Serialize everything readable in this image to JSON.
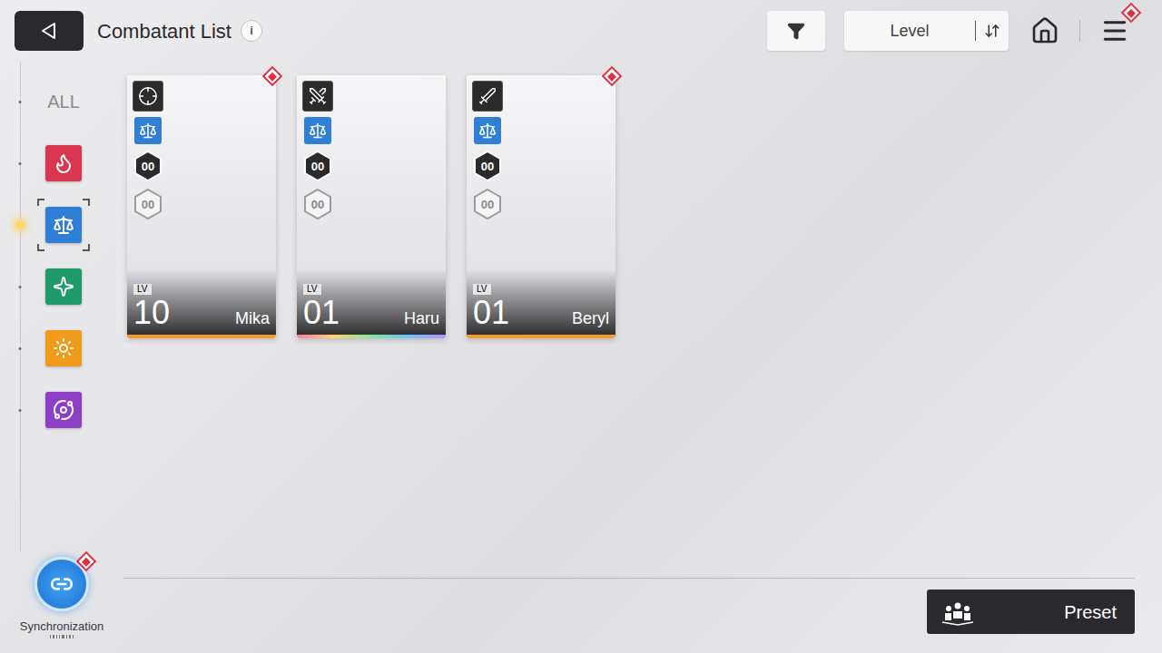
{
  "header": {
    "title": "Combatant List",
    "info": "i"
  },
  "toolbar": {
    "sort_label": "Level",
    "menu_badge": true
  },
  "sidebar": {
    "items": [
      {
        "label": "ALL",
        "kind": "text",
        "selected": false
      },
      {
        "kind": "icon",
        "color": "#d8374f",
        "selected": false
      },
      {
        "kind": "icon",
        "color": "#2f7fd6",
        "selected": true
      },
      {
        "kind": "icon",
        "color": "#1f9a6a",
        "selected": false
      },
      {
        "kind": "icon",
        "color": "#ef9a1a",
        "selected": false
      },
      {
        "kind": "icon",
        "color": "#8d3fc4",
        "selected": false
      }
    ]
  },
  "cards": [
    {
      "name": "Mika",
      "level_label": "LV",
      "level": "10",
      "role": "sniper",
      "badge": true,
      "frame_kind": "standard",
      "frame_color": "#f39a2c",
      "badges": [
        {
          "label": "00",
          "kind": "dark"
        },
        {
          "label": "00",
          "kind": "light"
        }
      ]
    },
    {
      "name": "Haru",
      "level_label": "LV",
      "level": "01",
      "role": "melee",
      "badge": false,
      "frame_kind": "prismatic",
      "badges": [
        {
          "label": "00",
          "kind": "dark"
        },
        {
          "label": "00",
          "kind": "light"
        }
      ]
    },
    {
      "name": "Beryl",
      "level_label": "LV",
      "level": "01",
      "role": "blade",
      "badge": true,
      "frame_kind": "standard",
      "frame_color": "#f39a2c",
      "badges": [
        {
          "label": "00",
          "kind": "dark"
        },
        {
          "label": "00",
          "kind": "light"
        }
      ]
    }
  ],
  "sync": {
    "label": "Synchronization",
    "badge": true
  },
  "preset": {
    "label": "Preset"
  }
}
